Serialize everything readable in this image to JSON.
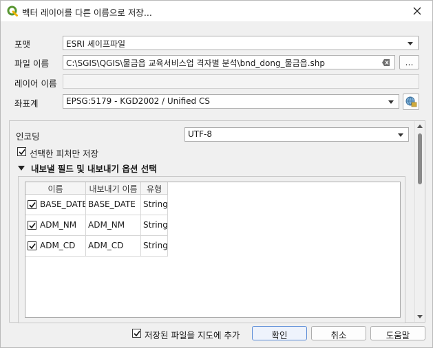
{
  "window": {
    "title": "벡터 레이어를 다른 이름으로 저장...",
    "accent_color": "#5a8bd6",
    "qgis_green": "#589632"
  },
  "form": {
    "format_label": "포맷",
    "format_value": "ESRI 셰이프파일",
    "filename_label": "파일 이름",
    "filename_value": "C:\\SGIS\\QGIS\\물금읍 교육서비스업 격자별 분석\\bnd_dong_물금읍.shp",
    "browse_label": "…",
    "layername_label": "레이어 이름",
    "layername_value": "",
    "crs_label": "좌표계",
    "crs_value": "EPSG:5179 - KGD2002 / Unified CS"
  },
  "options": {
    "encoding_label": "인코딩",
    "encoding_value": "UTF-8",
    "selected_only_label": "선택한 피처만 저장",
    "selected_only_checked": false,
    "section_title": "내보낼 필드 및 내보내기 옵션 선택"
  },
  "fields_table": {
    "headers": [
      "이름",
      "내보내기 이름",
      "유형"
    ],
    "rows": [
      {
        "checked": true,
        "name": "BASE_DATE",
        "export_name": "BASE_DATE",
        "type": "String"
      },
      {
        "checked": true,
        "name": "ADM_NM",
        "export_name": "ADM_NM",
        "type": "String"
      },
      {
        "checked": true,
        "name": "ADM_CD",
        "export_name": "ADM_CD",
        "type": "String"
      }
    ]
  },
  "footer": {
    "add_to_map_label": "저장된 파일을 지도에 추가",
    "add_to_map_checked": true,
    "ok_label": "확인",
    "cancel_label": "취소",
    "help_label": "도움말"
  }
}
